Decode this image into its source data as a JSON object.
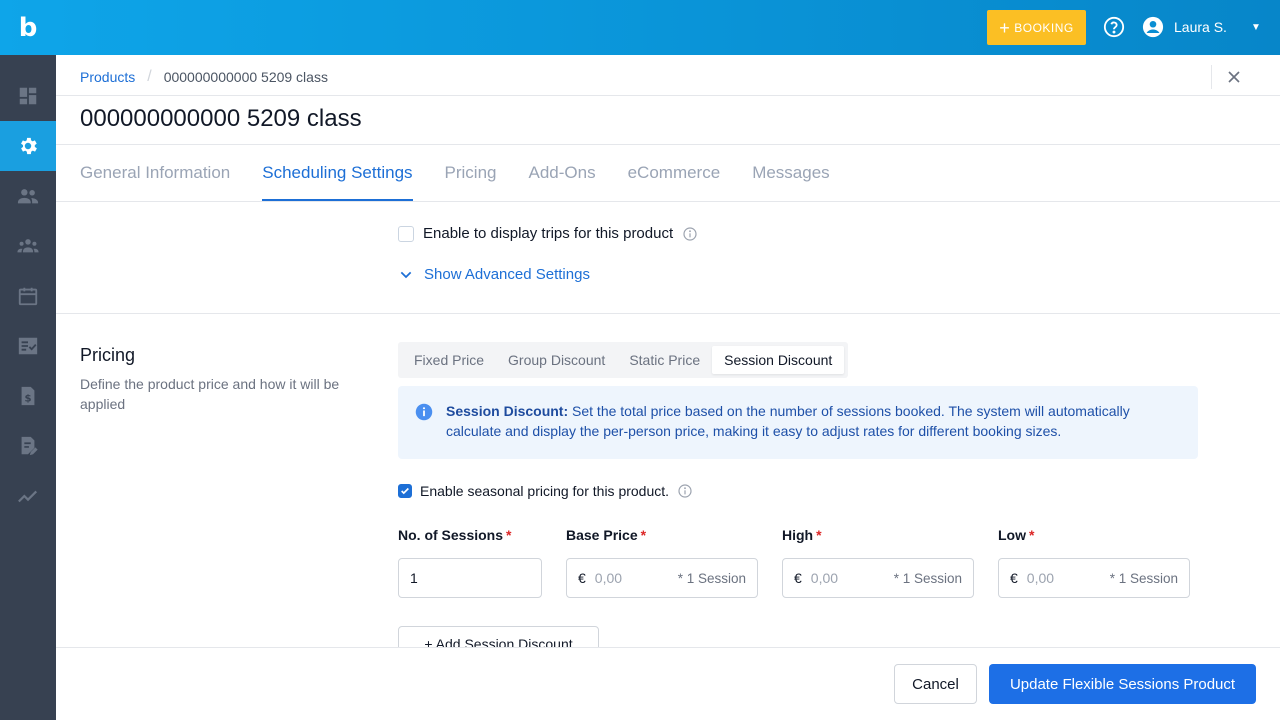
{
  "app": {
    "logo_text": "b"
  },
  "topbar": {
    "booking_label": "BOOKING",
    "user_name": "Laura S."
  },
  "sidebar": {
    "items": [
      {
        "name": "dashboard",
        "icon": "dashboard-icon"
      },
      {
        "name": "settings",
        "icon": "gear-icon",
        "active": true
      },
      {
        "name": "customers",
        "icon": "people-icon"
      },
      {
        "name": "groups",
        "icon": "group-icon"
      },
      {
        "name": "calendar",
        "icon": "calendar-icon"
      },
      {
        "name": "checklist",
        "icon": "checklist-icon"
      },
      {
        "name": "invoices",
        "icon": "invoice-icon"
      },
      {
        "name": "documents",
        "icon": "document-edit-icon"
      },
      {
        "name": "reports",
        "icon": "trend-icon"
      }
    ]
  },
  "breadcrumb": {
    "root": "Products",
    "current": "000000000000 5209 class"
  },
  "page": {
    "title": "000000000000 5209 class"
  },
  "tabs": [
    {
      "label": "General Information"
    },
    {
      "label": "Scheduling Settings",
      "active": true
    },
    {
      "label": "Pricing"
    },
    {
      "label": "Add-Ons"
    },
    {
      "label": "eCommerce"
    },
    {
      "label": "Messages"
    }
  ],
  "scheduling": {
    "trips_label": "Enable to display trips for this product",
    "advanced_label": "Show Advanced Settings"
  },
  "pricing": {
    "title": "Pricing",
    "description": "Define the product price and how it will be applied",
    "segments": [
      {
        "label": "Fixed Price"
      },
      {
        "label": "Group Discount"
      },
      {
        "label": "Static Price"
      },
      {
        "label": "Session Discount",
        "active": true
      }
    ],
    "alert": {
      "title": "Session Discount:",
      "text": "Set the total price based on the number of sessions booked. The system will automatically calculate and display the per-person price, making it easy to adjust rates for different booking sizes."
    },
    "seasonal_label": "Enable seasonal pricing for this product.",
    "fields": {
      "sessions": {
        "label": "No. of Sessions",
        "required": "*",
        "value": "1"
      },
      "base": {
        "label": "Base Price",
        "required": "*",
        "currency": "€",
        "placeholder": "0,00",
        "suffix": "* 1 Session"
      },
      "high": {
        "label": "High",
        "required": "*",
        "currency": "€",
        "placeholder": "0,00",
        "suffix": "* 1 Session"
      },
      "low": {
        "label": "Low",
        "required": "*",
        "currency": "€",
        "placeholder": "0,00",
        "suffix": "* 1 Session"
      }
    },
    "add_label": "+ Add Session Discount"
  },
  "footer": {
    "cancel_label": "Cancel",
    "submit_label": "Update Flexible Sessions Product"
  },
  "colors": {
    "primary": "#1d6fe6",
    "accent": "#fbbf24",
    "sidebar": "#374151",
    "topbar": "#0ea5e9"
  }
}
